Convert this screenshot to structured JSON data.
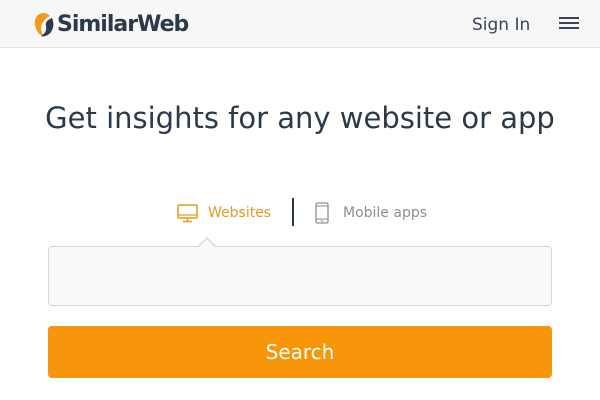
{
  "header": {
    "logo_text": "SimilarWeb",
    "sign_in_label": "Sign In",
    "menu_icon": "hamburger-menu-icon"
  },
  "main": {
    "headline": "Get insights for any website or app",
    "tabs": [
      {
        "label": "Websites",
        "icon": "desktop-monitor-icon",
        "active": true
      },
      {
        "label": "Mobile apps",
        "icon": "mobile-phone-icon",
        "active": false
      }
    ],
    "search": {
      "value": "",
      "placeholder": ""
    },
    "search_button_label": "Search"
  },
  "colors": {
    "accent": "#f7960b",
    "active_tab": "#e39a1f",
    "text_dark": "#2b3a4a",
    "inactive_tab": "#8a8f96",
    "logo_orange": "#f29a1e",
    "logo_dark": "#2b3a4a"
  }
}
